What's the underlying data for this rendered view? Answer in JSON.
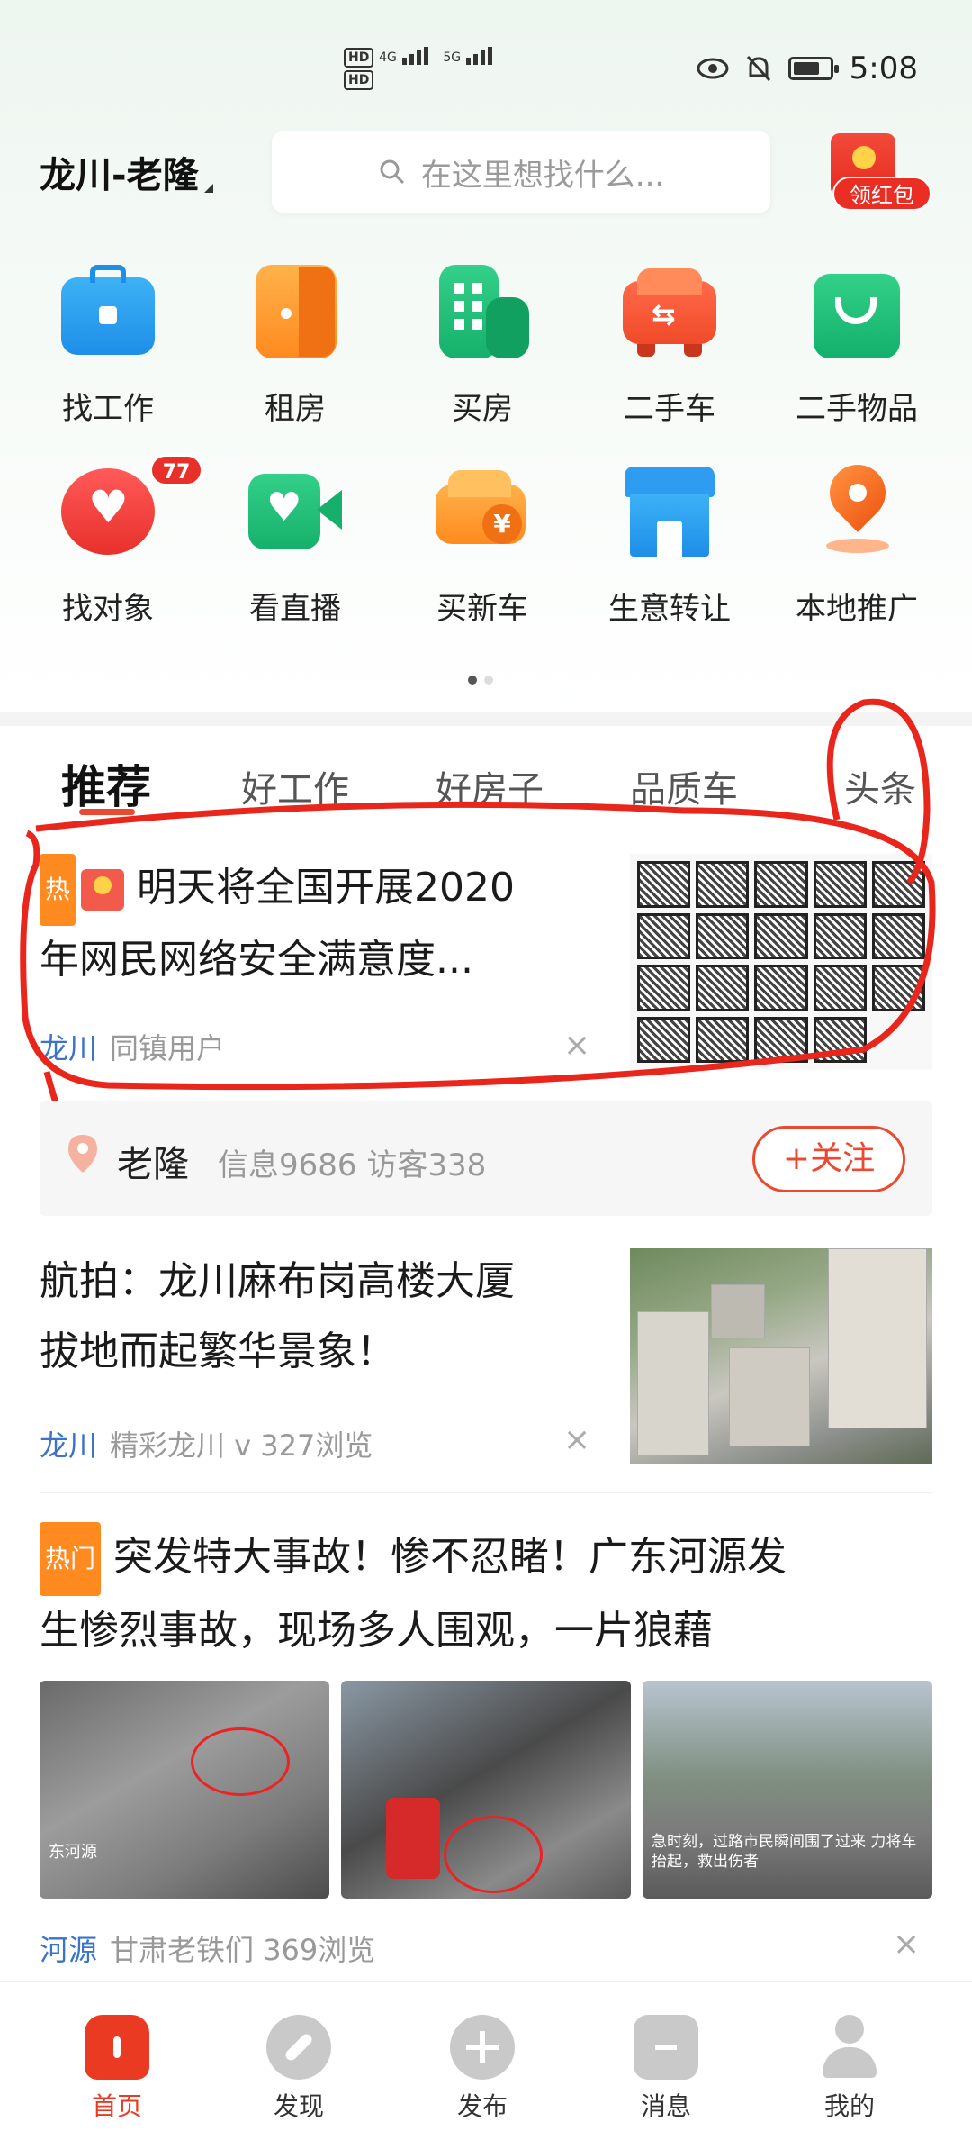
{
  "status_bar": {
    "time": "5:08",
    "net1": "4G",
    "net2": "5G"
  },
  "header": {
    "city": "龙川-老隆",
    "search_placeholder": "在这里想找什么...",
    "red_packet": "领红包"
  },
  "grid": [
    {
      "label": "找工作",
      "icon": "briefcase-icon"
    },
    {
      "label": "租房",
      "icon": "door-icon"
    },
    {
      "label": "买房",
      "icon": "building-icon"
    },
    {
      "label": "二手车",
      "icon": "used-car-icon"
    },
    {
      "label": "二手物品",
      "icon": "shopping-bag-icon"
    },
    {
      "label": "找对象",
      "icon": "heart-chat-icon",
      "badge": "77"
    },
    {
      "label": "看直播",
      "icon": "video-heart-icon"
    },
    {
      "label": "买新车",
      "icon": "new-car-icon"
    },
    {
      "label": "生意转让",
      "icon": "shop-icon"
    },
    {
      "label": "本地推广",
      "icon": "location-pin-icon"
    }
  ],
  "tabs": [
    "推荐",
    "好工作",
    "好房子",
    "品质车",
    "头条"
  ],
  "feed": {
    "item1": {
      "tag": "热",
      "title_line1": "明天将全国开展2020",
      "title_line2": "年网民网络安全满意度...",
      "loc": "龙川",
      "source": "同镇用户",
      "close": "×"
    },
    "author": {
      "name": "老隆",
      "info": "信息9686  访客338",
      "follow": "+关注"
    },
    "item2": {
      "title_line1": "航拍：龙川麻布岗高楼大厦",
      "title_line2": "拔地而起繁华景象！",
      "loc": "龙川",
      "source": "精彩龙川 v  327浏览",
      "close": "×"
    },
    "item3": {
      "tag": "热门",
      "title_line1": "突发特大事故！惨不忍睹！广东河源发",
      "title_line2": "生惨烈事故，现场多人围观，一片狼藉",
      "pic1_caption": "东河源",
      "pic3_caption": "急时刻，过路市民瞬间围了过来 力将车抬起，救出伤者",
      "loc": "河源",
      "source": "甘肃老铁们  369浏览",
      "close": "×"
    }
  },
  "nav": [
    {
      "label": "首页",
      "active": true
    },
    {
      "label": "发现"
    },
    {
      "label": "发布"
    },
    {
      "label": "消息"
    },
    {
      "label": "我的"
    }
  ],
  "colors": {
    "accent": "#ea4a2f",
    "loc_blue": "#3a73c8",
    "hot_orange": "#ff8a1f"
  }
}
